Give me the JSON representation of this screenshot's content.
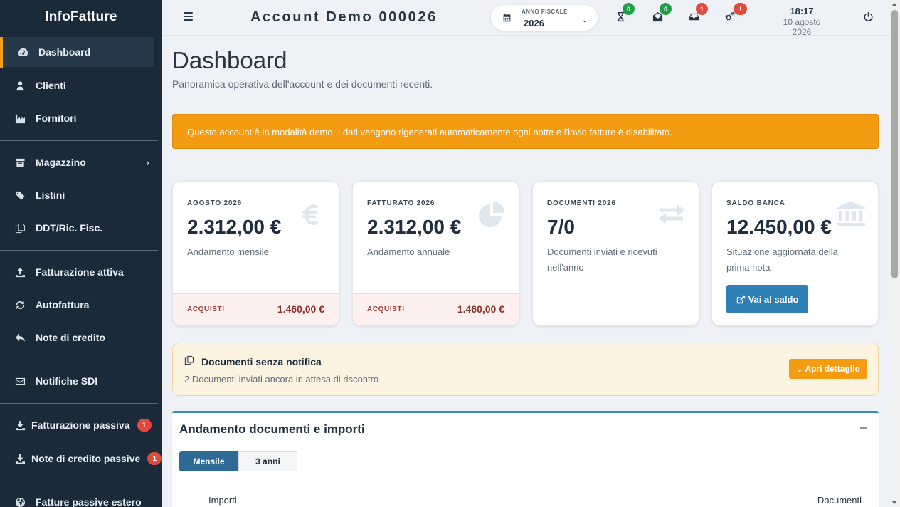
{
  "app": {
    "brand": "InfoFatture"
  },
  "sidebar": {
    "items": [
      {
        "label": "Dashboard",
        "icon": "dashboard-icon"
      },
      {
        "label": "Clienti",
        "icon": "user-icon"
      },
      {
        "label": "Fornitori",
        "icon": "factory-icon"
      },
      {
        "label": "Magazzino",
        "icon": "archive-icon"
      },
      {
        "label": "Listini",
        "icon": "tags-icon"
      },
      {
        "label": "DDT/Ric. Fisc.",
        "icon": "copy-icon"
      },
      {
        "label": "Fatturazione attiva",
        "icon": "upload-icon"
      },
      {
        "label": "Autofattura",
        "icon": "refresh-icon"
      },
      {
        "label": "Note di credito",
        "icon": "reply-icon"
      },
      {
        "label": "Notifiche SDI",
        "icon": "envelope-icon"
      },
      {
        "label": "Fatturazione passiva",
        "icon": "download-icon",
        "badge": "1"
      },
      {
        "label": "Note di credito passive",
        "icon": "download-icon",
        "badge": "1"
      },
      {
        "label": "Fatture passive estero",
        "icon": "globe-icon"
      }
    ]
  },
  "header": {
    "account_title": "Account Demo 000026",
    "fiscal_year_label": "ANNO FISCALE",
    "fiscal_year_value": "2026",
    "badges": {
      "pending": "0",
      "mail": "0",
      "inbox": "1",
      "settings": "!"
    },
    "time": "18:17",
    "date": "10 agosto 2026"
  },
  "page": {
    "title": "Dashboard",
    "subtitle": "Panoramica operativa dell'account e dei documenti recenti.",
    "alert": "Questo account è in modalità demo. I dati vengono rigenerati automaticamente ogni notte e l'invio fatture è disabilitato."
  },
  "cards": [
    {
      "label": "AGOSTO 2026",
      "value": "2.312,00 €",
      "desc": "Andamento mensile",
      "foot_label": "ACQUISTI",
      "foot_value": "1.460,00 €",
      "icon": "euro-icon"
    },
    {
      "label": "FATTURATO 2026",
      "value": "2.312,00 €",
      "desc": "Andamento annuale",
      "foot_label": "ACQUISTI",
      "foot_value": "1.460,00 €",
      "icon": "pie-chart-icon"
    },
    {
      "label": "DOCUMENTI 2026",
      "value": "7/0",
      "desc": "Documenti inviati e ricevuti nell'anno",
      "icon": "exchange-icon"
    },
    {
      "label": "SALDO BANCA",
      "value": "12.450,00 €",
      "desc": "Situazione aggiornata della prima nota",
      "button": "Vai al saldo",
      "icon": "bank-icon"
    }
  ],
  "notification": {
    "title": "Documenti senza notifica",
    "subtitle": "2 Documenti inviati ancora in attesa di riscontro",
    "button": "Apri dettaglio"
  },
  "panel": {
    "title": "Andamento documenti e importi",
    "tabs": [
      "Mensile",
      "3 anni"
    ],
    "axis_left": "Importi",
    "axis_right": "Documenti"
  },
  "colors": {
    "accent": "#f39c12",
    "primary": "#2e7fb4",
    "sidebar": "#1b2a38"
  }
}
